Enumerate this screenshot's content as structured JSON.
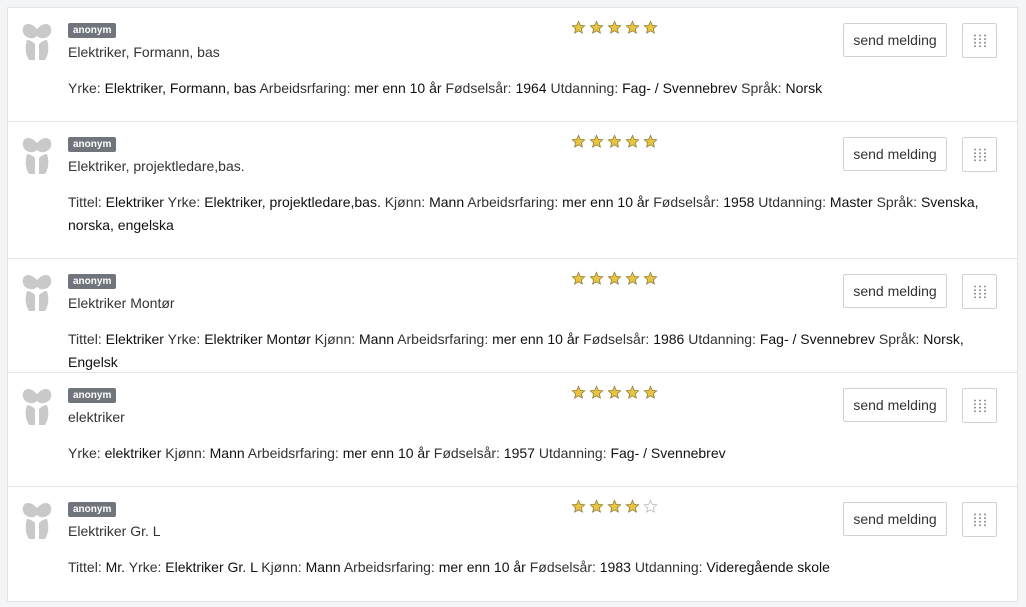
{
  "labels": {
    "anonymous_badge": "anonym",
    "send_message": "send melding"
  },
  "colors": {
    "star_filled": "#e9c43f",
    "star_empty": "#ffffff",
    "star_stroke": "#8a7a3a",
    "badge_bg": "#6f757b"
  },
  "candidates": [
    {
      "headline": "Elektriker, Formann, bas",
      "rating": 5,
      "fields": [
        {
          "label": "Yrke:",
          "value": "Elektriker, Formann, bas"
        },
        {
          "label": "Arbeidsrfaring:",
          "value": "mer enn 10 år"
        },
        {
          "label": "Fødselsår:",
          "value": "1964"
        },
        {
          "label": "Utdanning:",
          "value": "Fag- / Svennebrev"
        },
        {
          "label": "Språk:",
          "value": "Norsk"
        }
      ]
    },
    {
      "headline": "Elektriker, projektledare,bas.",
      "rating": 5,
      "fields": [
        {
          "label": "Tittel:",
          "value": "Elektriker"
        },
        {
          "label": "Yrke:",
          "value": "Elektriker, projektledare,bas."
        },
        {
          "label": "Kjønn:",
          "value": "Mann"
        },
        {
          "label": "Arbeidsrfaring:",
          "value": "mer enn 10 år"
        },
        {
          "label": "Fødselsår:",
          "value": "1958"
        },
        {
          "label": "Utdanning:",
          "value": "Master"
        },
        {
          "label": "Språk:",
          "value": "Svenska, norska, engelska"
        }
      ]
    },
    {
      "headline": "Elektriker Montør",
      "rating": 5,
      "fields": [
        {
          "label": "Tittel:",
          "value": "Elektriker"
        },
        {
          "label": "Yrke:",
          "value": "Elektriker Montør"
        },
        {
          "label": "Kjønn:",
          "value": "Mann"
        },
        {
          "label": "Arbeidsrfaring:",
          "value": "mer enn 10 år"
        },
        {
          "label": "Fødselsår:",
          "value": "1986"
        },
        {
          "label": "Utdanning:",
          "value": "Fag- / Svennebrev"
        },
        {
          "label": "Språk:",
          "value": "Norsk, Engelsk"
        }
      ]
    },
    {
      "headline": "elektriker",
      "rating": 5,
      "fields": [
        {
          "label": "Yrke:",
          "value": "elektriker"
        },
        {
          "label": "Kjønn:",
          "value": "Mann"
        },
        {
          "label": "Arbeidsrfaring:",
          "value": "mer enn 10 år"
        },
        {
          "label": "Fødselsår:",
          "value": "1957"
        },
        {
          "label": "Utdanning:",
          "value": "Fag- / Svennebrev"
        }
      ]
    },
    {
      "headline": "Elektriker Gr. L",
      "rating": 4,
      "fields": [
        {
          "label": "Tittel:",
          "value": "Mr."
        },
        {
          "label": "Yrke:",
          "value": "Elektriker Gr. L"
        },
        {
          "label": "Kjønn:",
          "value": "Mann"
        },
        {
          "label": "Arbeidsrfaring:",
          "value": "mer enn 10 år"
        },
        {
          "label": "Fødselsår:",
          "value": "1983"
        },
        {
          "label": "Utdanning:",
          "value": "Videregående skole"
        }
      ]
    }
  ]
}
